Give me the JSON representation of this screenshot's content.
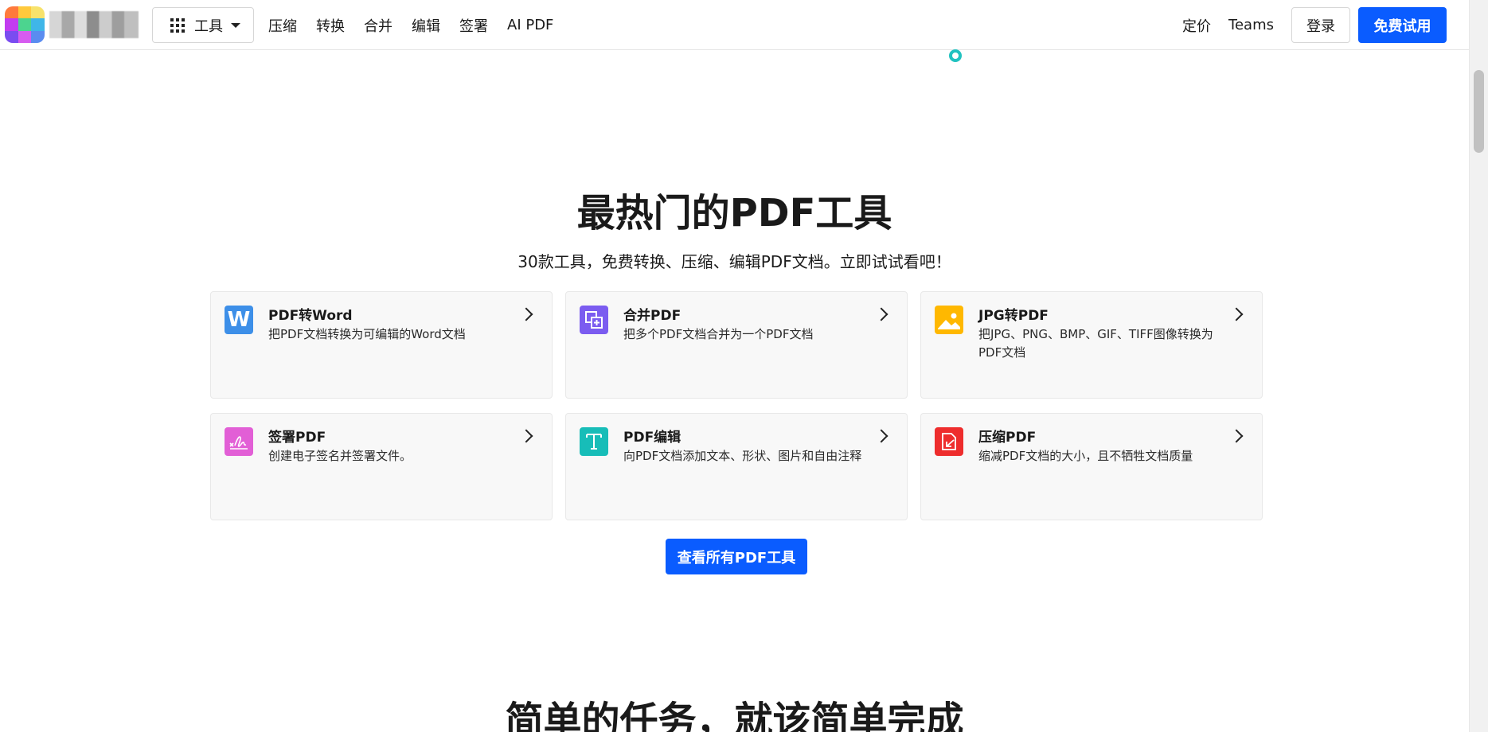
{
  "nav": {
    "tools_label": "工具",
    "links": [
      "压缩",
      "转换",
      "合并",
      "编辑",
      "签署",
      "AI PDF"
    ],
    "pricing": "定价",
    "teams": "Teams",
    "login": "登录",
    "free_trial": "免费试用"
  },
  "popular": {
    "title": "最热门的PDF工具",
    "subtitle": "30款工具，免费转换、压缩、编辑PDF文档。立即试试看吧！",
    "cards": [
      {
        "title": "PDF转Word",
        "desc": "把PDF文档转换为可编辑的Word文档",
        "icon": "word-icon",
        "color": "#3d8fe8"
      },
      {
        "title": "合并PDF",
        "desc": "把多个PDF文档合并为一个PDF文档",
        "icon": "merge-icon",
        "color": "#7b5cf0"
      },
      {
        "title": "JPG转PDF",
        "desc": "把JPG、PNG、BMP、GIF、TIFF图像转换为PDF文档",
        "icon": "image-icon",
        "color": "#ffb800"
      },
      {
        "title": "签署PDF",
        "desc": "创建电子签名并签署文件。",
        "icon": "signature-icon",
        "color": "#e25fd6"
      },
      {
        "title": "PDF编辑",
        "desc": "向PDF文档添加文本、形状、图片和自由注释",
        "icon": "text-icon",
        "color": "#17bdb8"
      },
      {
        "title": "压缩PDF",
        "desc": "缩减PDF文档的大小，且不牺牲文档质量",
        "icon": "compress-icon",
        "color": "#ee2d2d"
      }
    ],
    "view_all": "查看所有PDF工具"
  },
  "simple": {
    "title": "简单的任务，就该简单完成"
  },
  "colors": {
    "primary": "#0a5cff"
  }
}
